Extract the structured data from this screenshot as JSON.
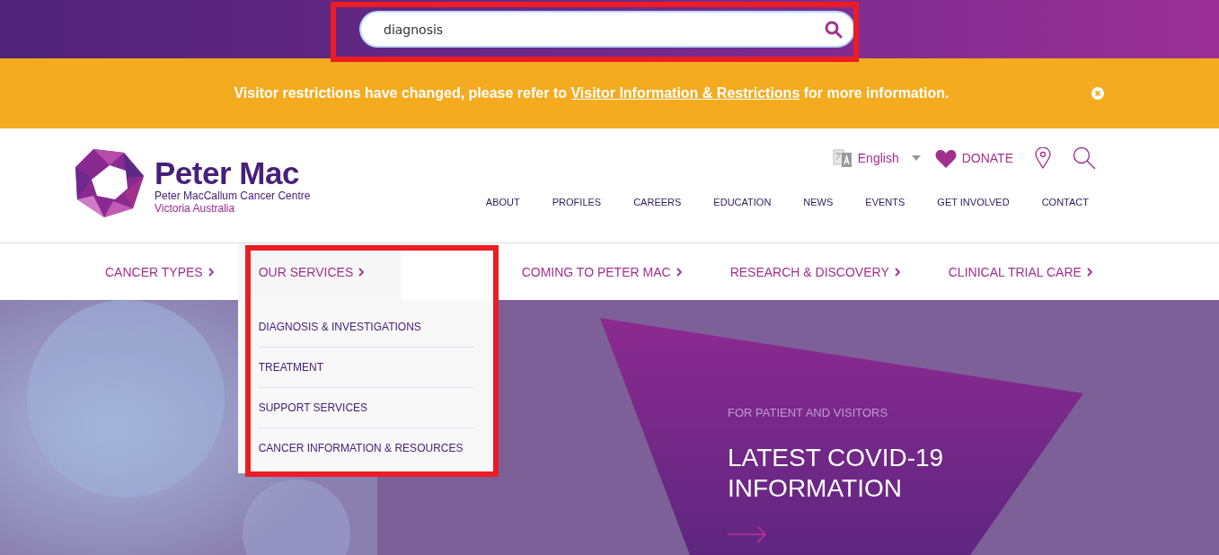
{
  "search": {
    "value": "diagnosis",
    "highlighted": true
  },
  "banner": {
    "text": "Visitor restrictions have changed, please refer to",
    "link": "Visitor Information & Restrictions",
    "text_after": "for more information."
  },
  "logo": {
    "name": "Peter Mac",
    "subtitle": "Peter MacCallum Cancer Centre",
    "location": "Victoria Australia"
  },
  "utility": {
    "language": "English",
    "donate": "DONATE"
  },
  "top_nav": [
    "ABOUT",
    "PROFILES",
    "CAREERS",
    "EDUCATION",
    "NEWS",
    "EVENTS",
    "GET INVOLVED",
    "CONTACT"
  ],
  "main_nav": [
    {
      "label": "CANCER TYPES",
      "selected": false
    },
    {
      "label": "OUR SERVICES",
      "selected": true
    },
    {
      "label": "COMING TO PETER MAC",
      "selected": false
    },
    {
      "label": "RESEARCH & DISCOVERY",
      "selected": false
    },
    {
      "label": "CLINICAL TRIAL CARE",
      "selected": false
    }
  ],
  "dropdown": {
    "highlighted": true,
    "items": [
      "DIAGNOSIS & INVESTIGATIONS",
      "TREATMENT",
      "SUPPORT SERVICES",
      "CANCER INFORMATION & RESOURCES"
    ]
  },
  "hero": {
    "eyebrow": "FOR PATIENT AND VISITORS",
    "title": "LATEST COVID-19 INFORMATION"
  }
}
